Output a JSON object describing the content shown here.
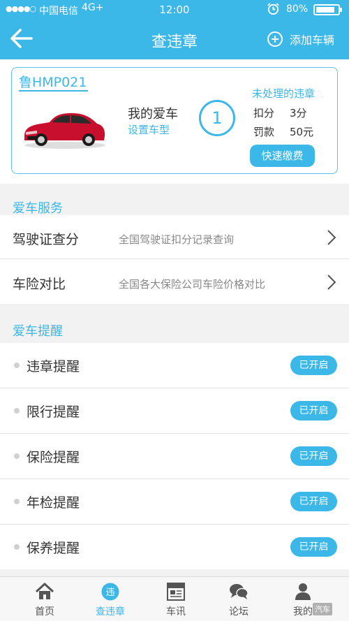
{
  "status_bar": {
    "signal": "●●●●○",
    "carrier": "中国电信",
    "network": "4G+",
    "time": "12:00",
    "battery": "80%"
  },
  "nav": {
    "title": "查违章",
    "add_label": "添加车辆"
  },
  "car_card": {
    "plate": "鲁HMP021",
    "car_name": "我的爱车",
    "set_model": "设置车型",
    "violation_count": "1",
    "violation_title": "未处理的违章",
    "deduct_label": "扣分",
    "deduct_value": "3分",
    "fine_label": "罚款",
    "fine_value": "50元",
    "pay_button": "快速缴费"
  },
  "services": {
    "title": "爱车服务",
    "items": [
      {
        "name": "驾驶证查分",
        "desc": "全国驾驶证扣分记录查询"
      },
      {
        "name": "车险对比",
        "desc": "全国各大保险公司车险价格对比"
      }
    ]
  },
  "reminders": {
    "title": "爱车提醒",
    "items": [
      {
        "name": "违章提醒",
        "status": "已开启"
      },
      {
        "name": "限行提醒",
        "status": "已开启"
      },
      {
        "name": "保险提醒",
        "status": "已开启"
      },
      {
        "name": "年检提醒",
        "status": "已开启"
      },
      {
        "name": "保养提醒",
        "status": "已开启"
      }
    ]
  },
  "tabs": [
    {
      "label": "首页",
      "icon": "home-icon"
    },
    {
      "label": "查违章",
      "icon": "violation-icon",
      "active": true
    },
    {
      "label": "车讯",
      "icon": "news-icon"
    },
    {
      "label": "论坛",
      "icon": "forum-icon"
    },
    {
      "label": "我的",
      "icon": "profile-icon"
    }
  ],
  "watermark": "汽车",
  "colors": {
    "accent": "#3bb7e8",
    "car_red": "#c8102e"
  }
}
